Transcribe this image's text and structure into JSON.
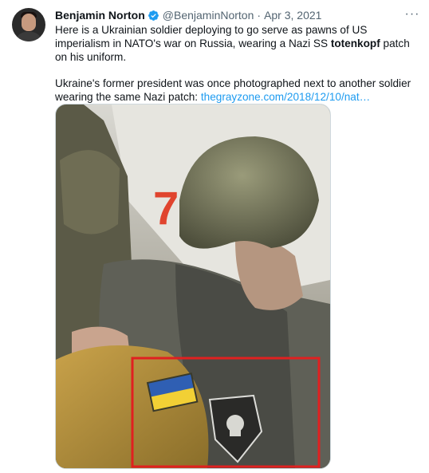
{
  "tweet": {
    "author_name": "Benjamin Norton",
    "handle": "@BenjaminNorton",
    "separator": "·",
    "date": "Apr 3, 2021",
    "more_label": "···",
    "line1_prefix": "Here is a Ukrainian soldier deploying to go serve as pawns of US imperialism in NATO's war on Russia, wearing a Nazi SS ",
    "line1_bold": "totenkopf",
    "line1_suffix": " patch on his uniform.",
    "line2_prefix": "Ukraine's former president was once photographed next to another soldier wearing the same Nazi patch: ",
    "link_text": "thegrayzone.com/2018/12/10/nat…"
  },
  "media": {
    "door_number": "7",
    "highlight_color": "#e02020"
  },
  "colors": {
    "link": "#1d9bf0",
    "verified": "#1d9bf0",
    "secondary_text": "#536471"
  }
}
